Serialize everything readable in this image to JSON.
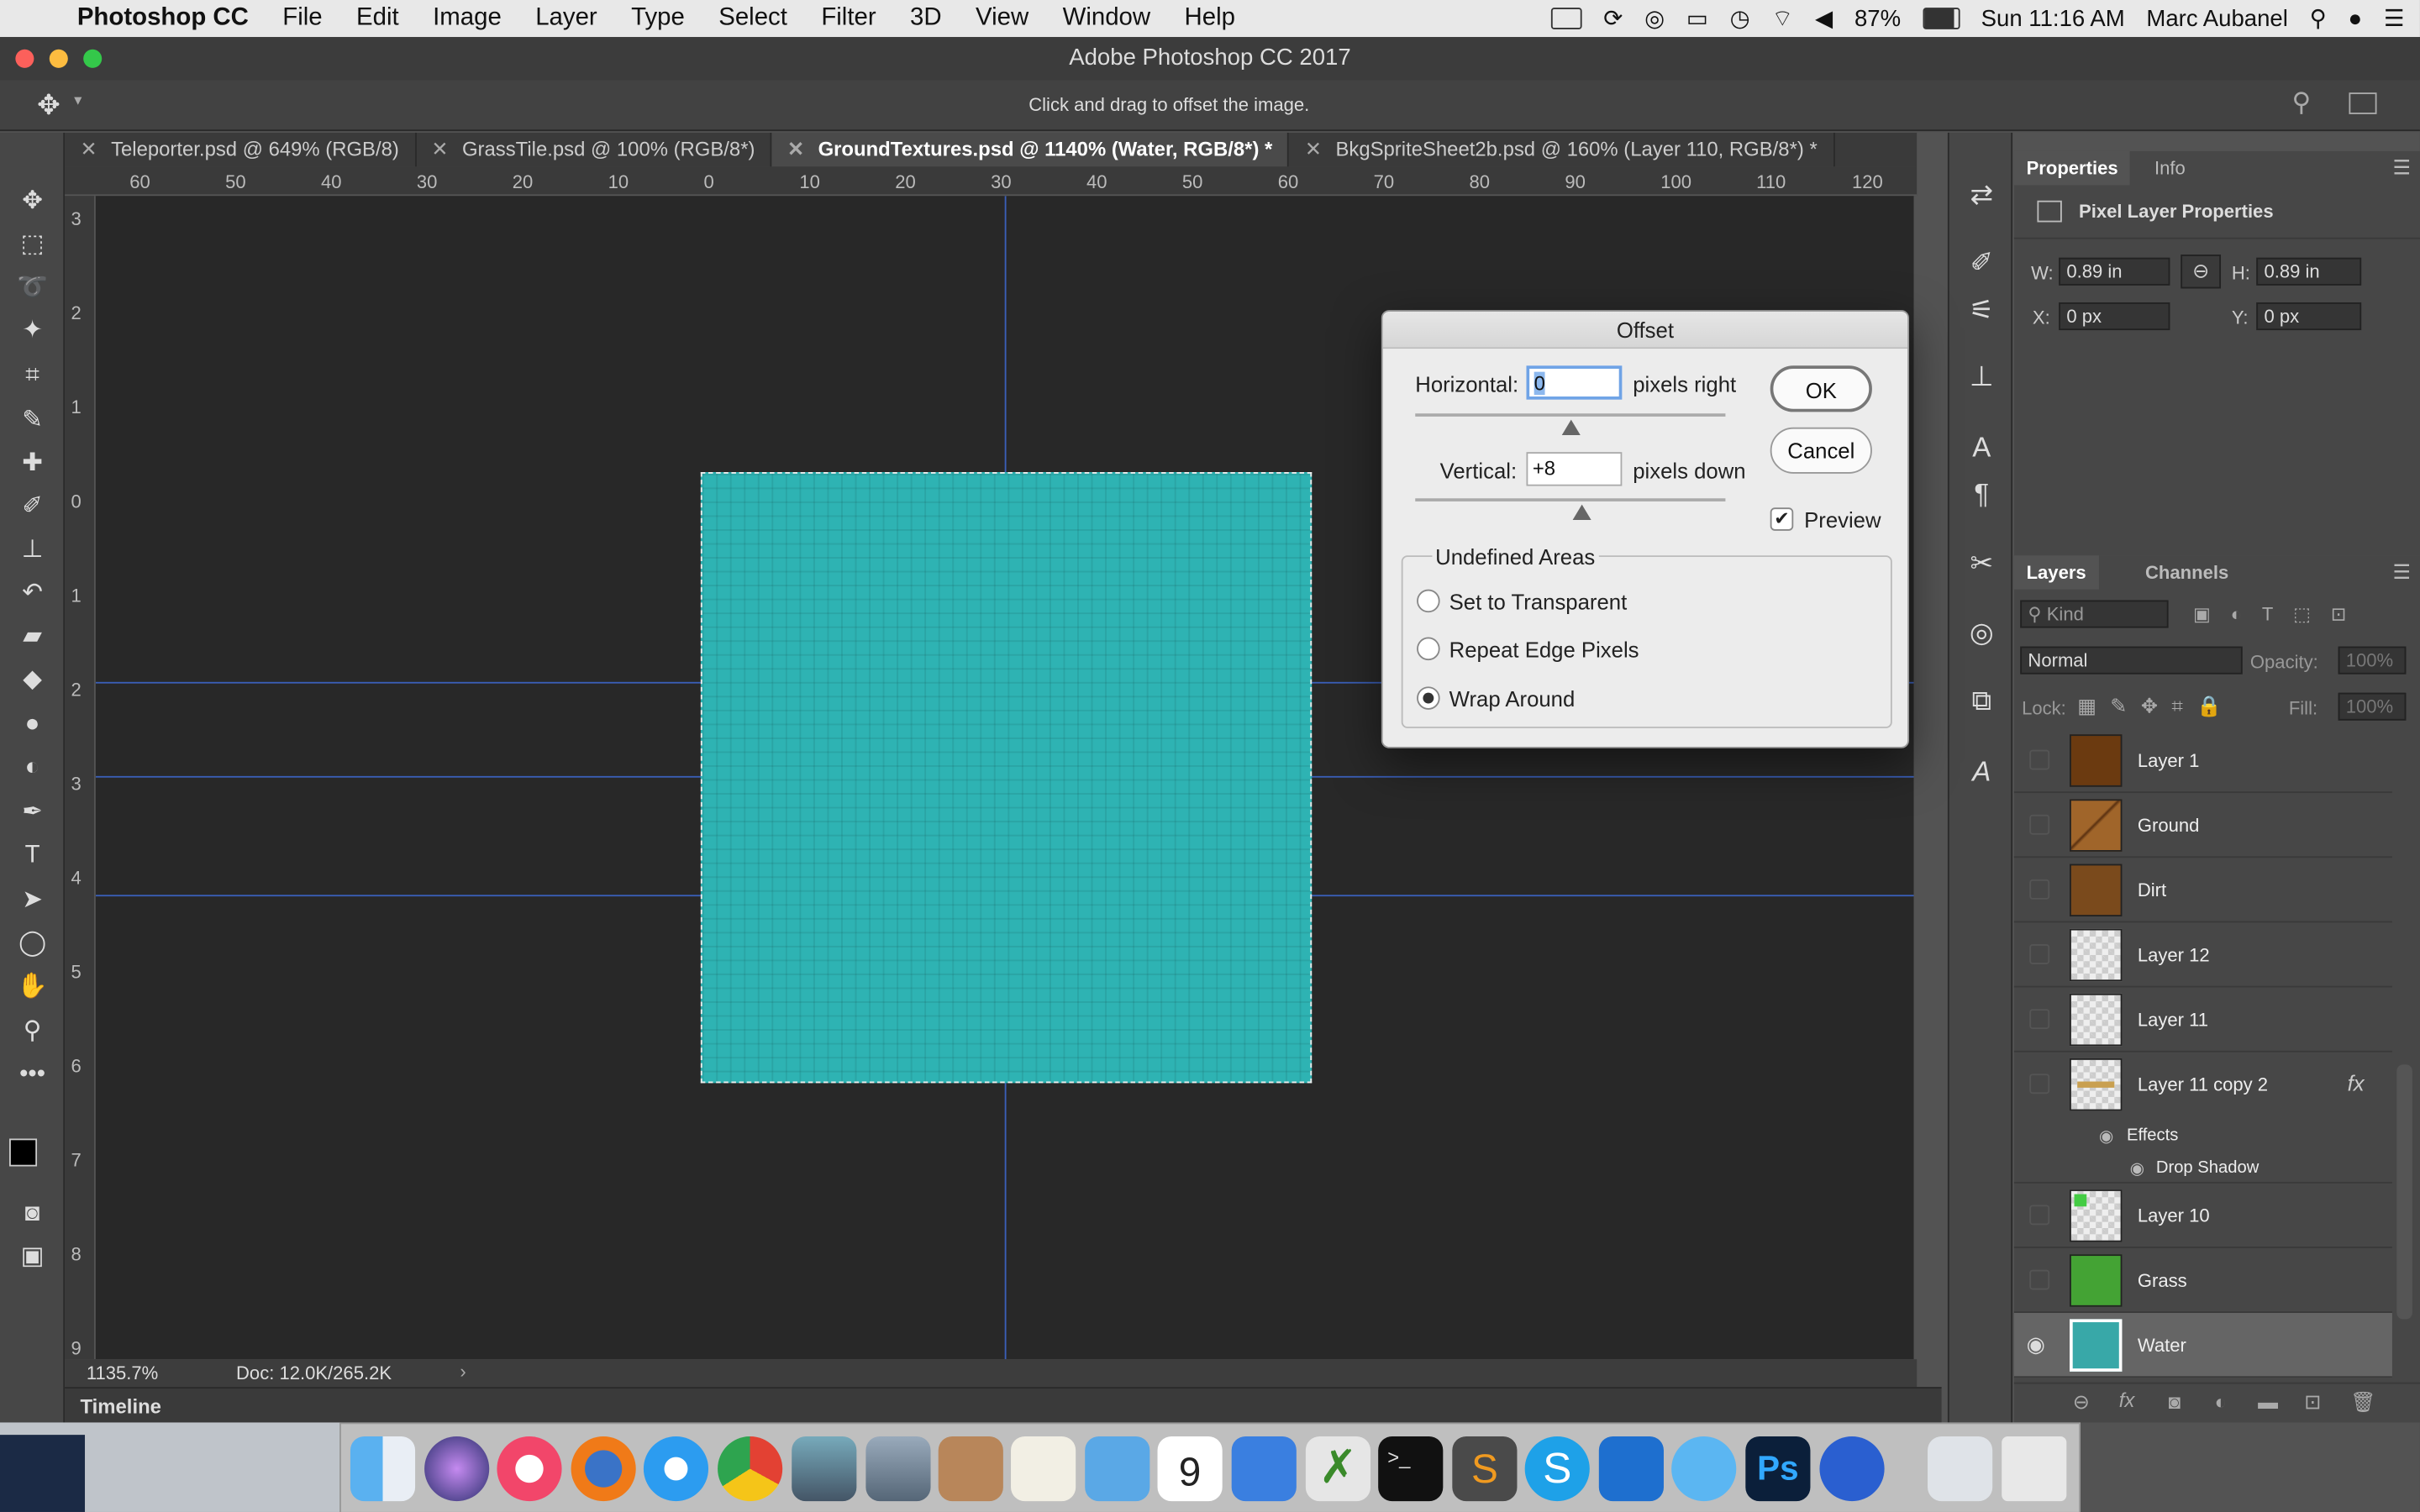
{
  "menubar": {
    "app_name": "Photoshop CC",
    "items": [
      "File",
      "Edit",
      "Image",
      "Layer",
      "Type",
      "Select",
      "Filter",
      "3D",
      "View",
      "Window",
      "Help"
    ],
    "battery": "87%",
    "clock": "Sun 11:16 AM",
    "user": "Marc Aubanel"
  },
  "window": {
    "title": "Adobe Photoshop CC 2017"
  },
  "options_bar": {
    "hint": "Click and drag to offset the image."
  },
  "tabs": [
    {
      "label": "Teleporter.psd @ 649% (RGB/8)"
    },
    {
      "label": "GrassTile.psd @ 100% (RGB/8*)"
    },
    {
      "label": "GroundTextures.psd @ 1140% (Water, RGB/8*) *"
    },
    {
      "label": "BkgSpriteSheet2b.psd @ 160% (Layer 110, RGB/8*) *"
    }
  ],
  "ruler": {
    "h_labels": [
      "60",
      "50",
      "40",
      "30",
      "20",
      "10",
      "0",
      "10",
      "20",
      "30",
      "40",
      "50",
      "60",
      "70",
      "80",
      "90",
      "100",
      "110",
      "120"
    ],
    "v_labels": [
      "3",
      "2",
      "1",
      "0",
      "1",
      "2",
      "3",
      "4",
      "5",
      "6",
      "7",
      "8",
      "9"
    ]
  },
  "status": {
    "zoom": "1135.7%",
    "doc": "Doc: 12.0K/265.2K"
  },
  "timeline": {
    "label": "Timeline"
  },
  "properties": {
    "tab_properties": "Properties",
    "tab_info": "Info",
    "subtitle": "Pixel Layer Properties",
    "w_label": "W:",
    "w_value": "0.89 in",
    "h_label": "H:",
    "h_value": "0.89 in",
    "x_label": "X:",
    "x_value": "0 px",
    "y_label": "Y:",
    "y_value": "0 px"
  },
  "layers_panel": {
    "tab_layers": "Layers",
    "tab_channels": "Channels",
    "kind_placeholder": "Kind",
    "blend_mode": "Normal",
    "opacity_label": "Opacity:",
    "opacity_value": "100%",
    "lock_label": "Lock:",
    "fill_label": "Fill:",
    "fill_value": "100%",
    "layers": [
      {
        "name": "Layer 1"
      },
      {
        "name": "Ground"
      },
      {
        "name": "Dirt"
      },
      {
        "name": "Layer 12"
      },
      {
        "name": "Layer 11"
      },
      {
        "name": "Layer 11 copy 2"
      },
      {
        "name": "Layer 10"
      },
      {
        "name": "Grass"
      },
      {
        "name": "Water"
      }
    ],
    "effects_label": "Effects",
    "drop_shadow_label": "Drop Shadow",
    "fx_label": "fx"
  },
  "offset_dialog": {
    "title": "Offset",
    "horizontal_label": "Horizontal:",
    "horizontal_value": "0",
    "horizontal_unit": "pixels right",
    "vertical_label": "Vertical:",
    "vertical_value": "+8",
    "vertical_unit": "pixels down",
    "ok": "OK",
    "cancel": "Cancel",
    "preview_label": "Preview",
    "preview_checked": true,
    "group_label": "Undefined Areas",
    "options": [
      "Set to Transparent",
      "Repeat Edge Pixels",
      "Wrap Around"
    ],
    "selected_option": "Wrap Around"
  },
  "colors": {
    "image_fill": "#2eb3b3",
    "guide": "#3a5fb8",
    "accent": "#3b7ed8"
  }
}
